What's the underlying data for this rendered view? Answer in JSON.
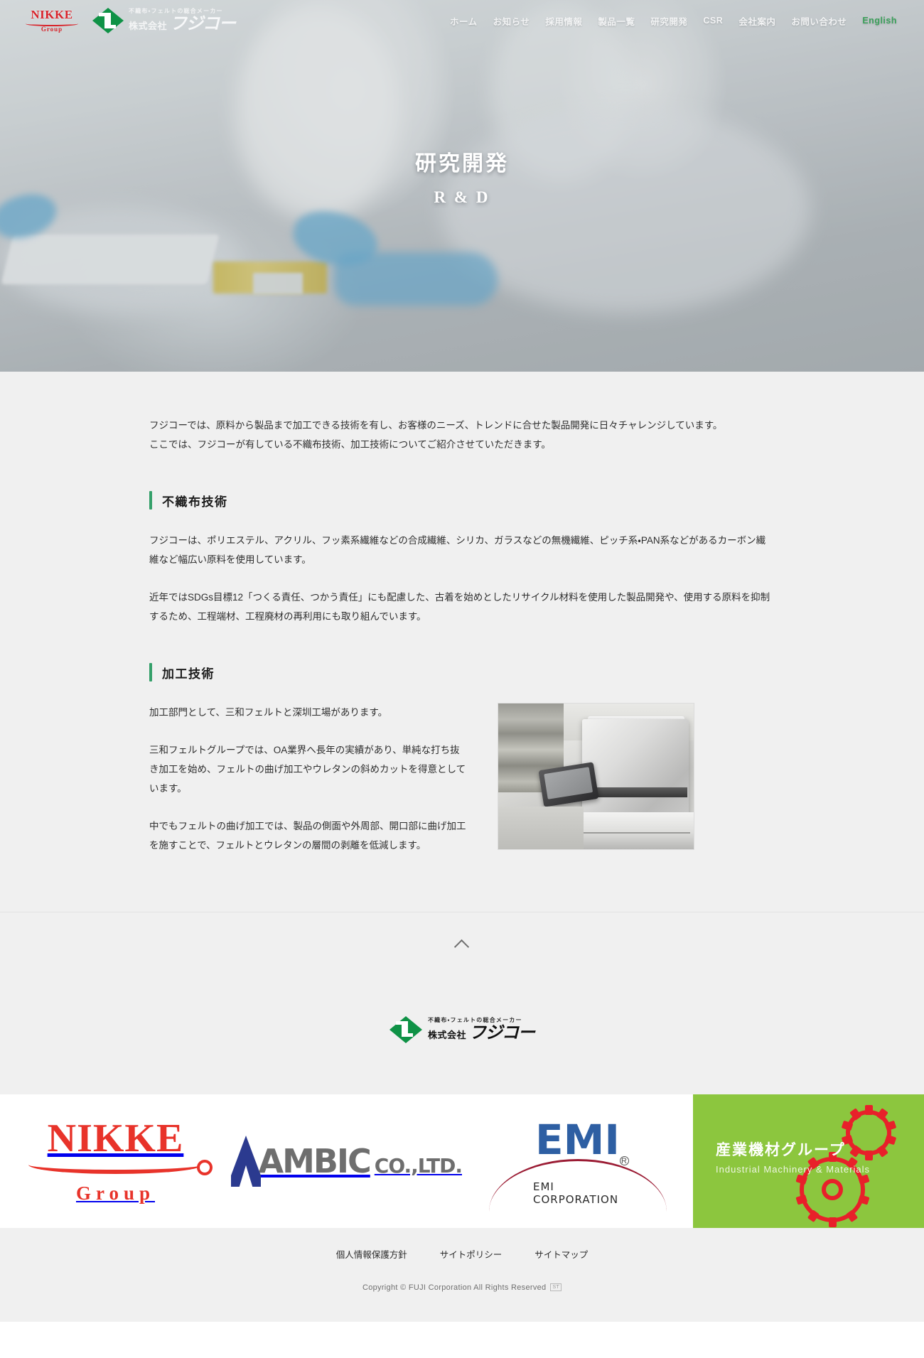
{
  "header": {
    "nikke_logo": {
      "word": "NIKKE",
      "sub": "Group"
    },
    "fujiko_logo": {
      "tagline": "不織布・フェルトの総合メーカー",
      "kk": "株式会社",
      "name": "フジコー"
    },
    "nav": [
      {
        "label": "ホーム",
        "name": "nav-home"
      },
      {
        "label": "お知らせ",
        "name": "nav-news"
      },
      {
        "label": "採用情報",
        "name": "nav-recruit"
      },
      {
        "label": "製品一覧",
        "name": "nav-products"
      },
      {
        "label": "研究開発",
        "name": "nav-rd"
      },
      {
        "label": "CSR",
        "name": "nav-csr"
      },
      {
        "label": "会社案内",
        "name": "nav-company"
      },
      {
        "label": "お問い合わせ",
        "name": "nav-contact"
      },
      {
        "label": "English",
        "name": "nav-english"
      }
    ],
    "english_color": "#3aa05a"
  },
  "hero": {
    "title_jp": "研究開発",
    "title_en": "R & D"
  },
  "main": {
    "lead_line1": "フジコーでは、原料から製品まで加工できる技術を有し、お客様のニーズ、トレンドに合せた製品開発に日々チャレンジしています。",
    "lead_line2": "ここでは、フジコーが有している不織布技術、加工技術についてご紹介させていただきます。",
    "accent_color": "#34a06a",
    "section1": {
      "title": "不織布技術",
      "para1": "フジコーは、ポリエステル、アクリル、フッ素系繊維などの合成繊維、シリカ、ガラスなどの無機繊維、ピッチ系・PAN系などがあるカーボン繊維など幅広い原料を使用しています。",
      "para2": "近年ではSDGs目標12「つくる責任、つかう責任」にも配慮した、古着を始めとしたリサイクル材料を使用した製品開発や、使用する原料を抑制するため、工程端材、工程廃材の再利用にも取り組んでいます。"
    },
    "section2": {
      "title": "加工技術",
      "para1": "加工部門として、三和フェルトと深圳工場があります。",
      "para2": "三和フェルトグループでは、OA業界へ長年の実績があり、単純な打ち抜き加工を始め、フェルトの曲げ加工やウレタンの斜めカットを得意としています。",
      "para3": "中でもフェルトの曲げ加工では、製品の側面や外周部、開口部に曲げ加工を施すことで、フェルトとウレタンの層間の剥離を低減します。",
      "photo_alt": "コピー機（OA機器）の写真"
    }
  },
  "pagetop": {
    "label": "ページトップへ戻る"
  },
  "footer": {
    "logo": {
      "tagline": "不織布・フェルトの総合メーカー",
      "kk": "株式会社",
      "name": "フジコー"
    },
    "banners": [
      {
        "name": "banner-nikke",
        "word": "NIKKE",
        "sub": "Group"
      },
      {
        "name": "banner-ambic",
        "word": "AMBIC",
        "sub": "CO.,LTD."
      },
      {
        "name": "banner-emi",
        "word": "EMI",
        "sub": "EMI CORPORATION",
        "reg": "R"
      },
      {
        "name": "banner-sangyo",
        "jp": "産業機材グループ",
        "en": "Industrial Machinery & Materials",
        "bg": "#8cc63e"
      }
    ],
    "links": [
      {
        "label": "個人情報保護方針",
        "name": "footer-link-privacy"
      },
      {
        "label": "サイトポリシー",
        "name": "footer-link-sitepolicy"
      },
      {
        "label": "サイトマップ",
        "name": "footer-link-sitemap"
      }
    ],
    "copyright": "Copyright © FUJI Corporation  All Rights Reserved",
    "copyright_badge": "ST"
  }
}
